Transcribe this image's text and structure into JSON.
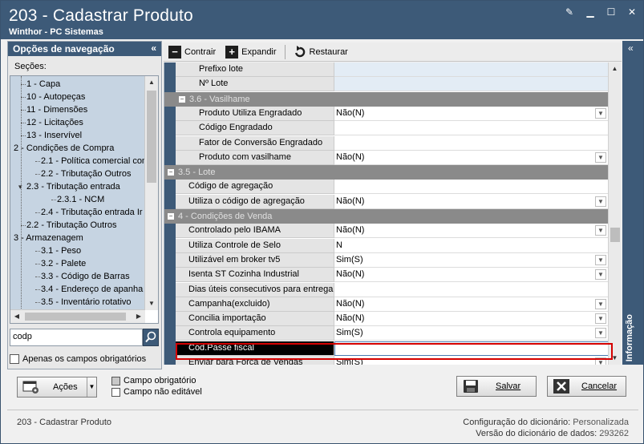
{
  "window": {
    "title": "203 - Cadastrar  Produto",
    "subtitle": "Winthor - PC Sistemas"
  },
  "nav": {
    "header": "Opções de navegação",
    "sections_label": "Seções:",
    "items": [
      {
        "label": "1 - Capa"
      },
      {
        "label": "10 - Autopeças"
      },
      {
        "label": "11 - Dimensões"
      },
      {
        "label": "12 - Licitações"
      },
      {
        "label": "13 - Inservível"
      },
      {
        "label": "2 - Condições de Compra"
      },
      {
        "label": "2.1 - Política comercial com"
      },
      {
        "label": "2.2 - Tributação Outros"
      },
      {
        "label": "2.3 - Tributação entrada"
      },
      {
        "label": "2.3.1 - NCM"
      },
      {
        "label": "2.4 - Tributação entrada Ir"
      },
      {
        "label": "2.2 - Tributação Outros"
      },
      {
        "label": "3 - Armazenagem"
      },
      {
        "label": "3.1 - Peso"
      },
      {
        "label": "3.2 - Palete"
      },
      {
        "label": "3.3 - Código de Barras"
      },
      {
        "label": "3.4 - Endereço de apanha"
      },
      {
        "label": "3.5 - Inventário rotativo"
      }
    ],
    "search_value": "codp",
    "only_required_label": "Apenas os campos obrigatórios"
  },
  "toolbar": {
    "collapse": "Contrair",
    "expand": "Expandir",
    "restore": "Restaurar"
  },
  "grid": {
    "rows": [
      {
        "kind": "field",
        "label": "Prefixo lote",
        "value": ""
      },
      {
        "kind": "field",
        "label": "Nº Lote",
        "value": ""
      },
      {
        "kind": "group",
        "label": "3.6 - Vasilhame"
      },
      {
        "kind": "field",
        "label": "Produto Utiliza Engradado",
        "value": "Não(N)"
      },
      {
        "kind": "field",
        "label": "Código Engradado",
        "value": ""
      },
      {
        "kind": "field",
        "label": "Fator de Conversão Engradado",
        "value": ""
      },
      {
        "kind": "field",
        "label": "Produto com vasilhame",
        "value": "Não(N)"
      },
      {
        "kind": "group",
        "label": "3.5 - Lote"
      },
      {
        "kind": "field",
        "label": "Código de agregação",
        "value": ""
      },
      {
        "kind": "field",
        "label": "Utiliza o código de agregação",
        "value": "Não(N)"
      },
      {
        "kind": "group",
        "label": "4 - Condições de Venda"
      },
      {
        "kind": "field",
        "label": "Controlado pelo IBAMA",
        "value": "Não(N)"
      },
      {
        "kind": "field",
        "label": "Utiliza Controle de Selo",
        "value": "N"
      },
      {
        "kind": "field",
        "label": "Utilizável em broker tv5",
        "value": "Sim(S)"
      },
      {
        "kind": "field",
        "label": "Isenta ST Cozinha Industrial",
        "value": "Não(N)"
      },
      {
        "kind": "field",
        "label": "Dias úteis consecutivos para entrega",
        "value": ""
      },
      {
        "kind": "field",
        "label": "Campanha(excluido)",
        "value": "Não(N)"
      },
      {
        "kind": "field",
        "label": "Concilia importação",
        "value": "Não(N)"
      },
      {
        "kind": "field",
        "label": "Controla equipamento",
        "value": "Sim(S)"
      },
      {
        "kind": "field",
        "label": "Cód.Passe fiscal",
        "value": ""
      },
      {
        "kind": "field",
        "label": "Enviar para Força de Vendas",
        "value": "Sim(S)"
      }
    ]
  },
  "info_panel": {
    "label": "Informação"
  },
  "footer": {
    "actions_label": "Ações",
    "legend_required": "Campo obrigatório",
    "legend_not_editable": "Campo não editável",
    "save_label": "Salvar",
    "cancel_label": "Cancelar"
  },
  "status": {
    "left": "203 - Cadastrar  Produto",
    "config_label": "Configuração do dicionário:",
    "config_value": "Personalizada",
    "version_label": "Versão do dicionário de dados:",
    "version_value": "293262"
  },
  "colors": {
    "title_bar": "#3d5a78",
    "group_row": "#8a8a8a",
    "highlight": "#d40000"
  }
}
